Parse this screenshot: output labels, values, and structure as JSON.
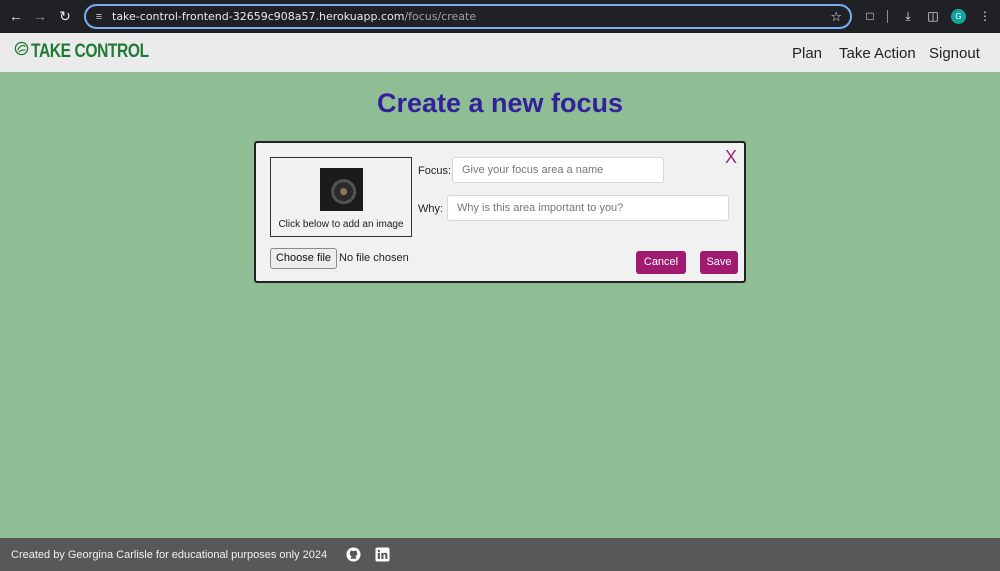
{
  "browser": {
    "url_host": "take-control-frontend-32659c908a57.herokuapp.com",
    "url_path": "/focus/create",
    "profile_initial": "G",
    "icons": [
      "back-arrow-icon",
      "forward-arrow-icon",
      "reload-icon",
      "site-settings-icon",
      "star-icon",
      "extensions-icon",
      "download-icon",
      "side-panel-icon",
      "kebab-menu-icon"
    ]
  },
  "nav": {
    "brand": "TAKE CONTROL",
    "links": [
      "Plan",
      "Take Action",
      "Signout"
    ]
  },
  "page": {
    "title": "Create a new focus"
  },
  "form": {
    "image_caption": "Click below to add an image",
    "file_button": "Choose file",
    "file_status": "No file chosen",
    "focus_label": "Focus:",
    "focus_placeholder": "Give your focus area a name",
    "why_label": "Why:",
    "why_placeholder": "Why is this area important to you?",
    "close": "X",
    "cancel": "Cancel",
    "save": "Save"
  },
  "footer": {
    "text": "Created by Georgina Carlisle for educational purposes only  2024"
  },
  "colors": {
    "background": "#8fbe95",
    "title": "#34209a",
    "accent": "#a01a70",
    "brand": "#1f7a35",
    "footer": "#585858"
  }
}
